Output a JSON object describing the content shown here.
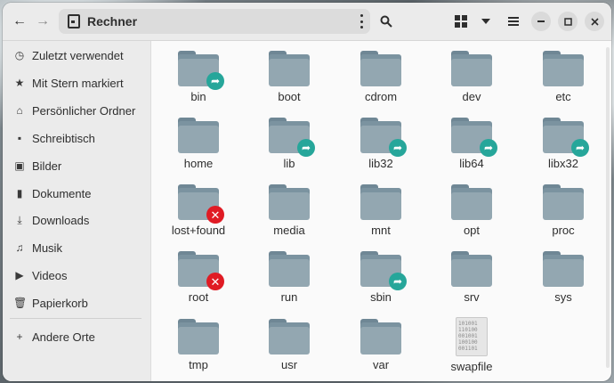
{
  "window": {
    "title": "Rechner"
  },
  "header": {
    "back_icon": "arrow-left-icon",
    "forward_icon": "arrow-right-icon",
    "location": "Rechner",
    "menu_icon": "vertical-dots-icon",
    "search_icon": "search-icon",
    "view_icon": "grid-view-icon",
    "sort_icon": "chevron-down-icon",
    "hamburger_icon": "hamburger-menu-icon"
  },
  "sidebar": {
    "items": [
      {
        "label": "Zuletzt verwendet",
        "icon": "clock-icon"
      },
      {
        "label": "Mit Stern markiert",
        "icon": "star-icon"
      },
      {
        "label": "Persönlicher Ordner",
        "icon": "home-icon"
      },
      {
        "label": "Schreibtisch",
        "icon": "desktop-icon"
      },
      {
        "label": "Bilder",
        "icon": "image-icon"
      },
      {
        "label": "Dokumente",
        "icon": "document-icon"
      },
      {
        "label": "Downloads",
        "icon": "download-icon"
      },
      {
        "label": "Musik",
        "icon": "music-icon"
      },
      {
        "label": "Videos",
        "icon": "video-icon"
      },
      {
        "label": "Papierkorb",
        "icon": "trash-icon"
      }
    ],
    "other": {
      "label": "Andere Orte",
      "icon": "plus-icon"
    }
  },
  "files": [
    {
      "name": "bin",
      "badge": "link"
    },
    {
      "name": "boot",
      "badge": ""
    },
    {
      "name": "cdrom",
      "badge": ""
    },
    {
      "name": "dev",
      "badge": ""
    },
    {
      "name": "etc",
      "badge": ""
    },
    {
      "name": "home",
      "badge": ""
    },
    {
      "name": "lib",
      "badge": "link"
    },
    {
      "name": "lib32",
      "badge": "link"
    },
    {
      "name": "lib64",
      "badge": "link"
    },
    {
      "name": "libx32",
      "badge": "link"
    },
    {
      "name": "lost+found",
      "badge": "error"
    },
    {
      "name": "media",
      "badge": ""
    },
    {
      "name": "mnt",
      "badge": ""
    },
    {
      "name": "opt",
      "badge": ""
    },
    {
      "name": "proc",
      "badge": ""
    },
    {
      "name": "root",
      "badge": "error"
    },
    {
      "name": "run",
      "badge": ""
    },
    {
      "name": "sbin",
      "badge": "link"
    },
    {
      "name": "srv",
      "badge": ""
    },
    {
      "name": "sys",
      "badge": ""
    },
    {
      "name": "tmp",
      "badge": ""
    },
    {
      "name": "usr",
      "badge": ""
    },
    {
      "name": "var",
      "badge": ""
    },
    {
      "name": "swapfile",
      "badge": "error",
      "type": "file",
      "content": "101001\n110100\n001001\n100100\n001101"
    }
  ],
  "colors": {
    "link_badge": "#26a69a",
    "error_badge": "#e01b24",
    "folder": "#93a7b1"
  }
}
